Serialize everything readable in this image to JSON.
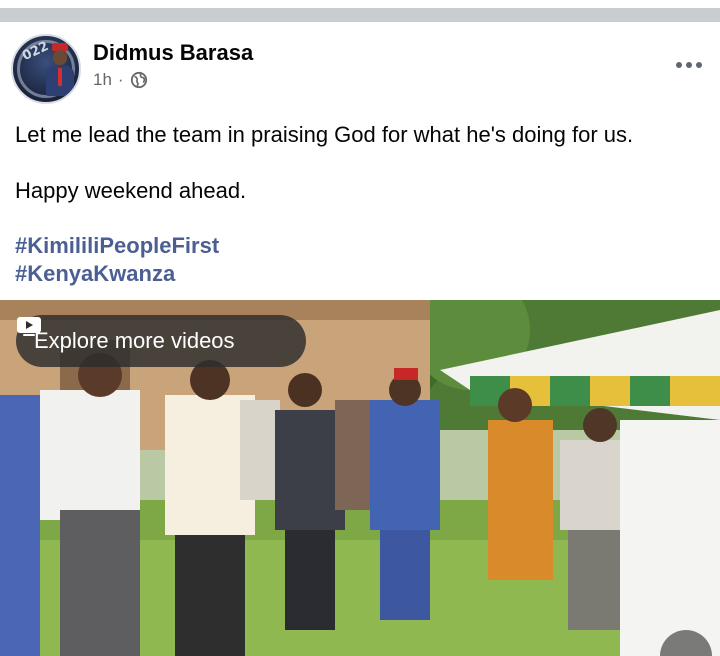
{
  "post": {
    "author": "Didmus Barasa",
    "time": "1h",
    "separator": "·",
    "body_line1": "Let me lead the team in praising God for what he's doing for us.",
    "body_line2": "Happy weekend ahead.",
    "hashtags": [
      "#KimililiPeopleFirst",
      "#KenyaKwanza"
    ]
  },
  "video": {
    "explore_label": "Explore more videos"
  },
  "icons": {
    "privacy": "globe-icon",
    "options": "more-options-icon",
    "video": "video-play-icon"
  },
  "colors": {
    "hashtag": "#4b5f94",
    "meta": "#65676b",
    "divider": "#c9ccd1"
  }
}
